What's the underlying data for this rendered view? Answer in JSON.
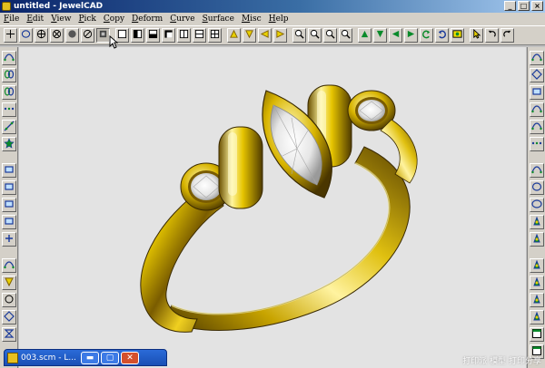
{
  "window": {
    "title": "untitled - JewelCAD",
    "controls": [
      "minimize",
      "maximize",
      "close"
    ],
    "control_glyphs": [
      "_",
      "□",
      "×"
    ]
  },
  "menu": [
    "File",
    "Edit",
    "View",
    "Pick",
    "Copy",
    "Deform",
    "Curve",
    "Surface",
    "Misc",
    "Help"
  ],
  "toolbar": {
    "buttons": [
      "crosshair-icon",
      "circle-icon",
      "target-icon",
      "circle-cross-icon",
      "filled-circle-icon",
      "slashed-circle-icon",
      "render-mode-icon",
      "view-square-icon",
      "view-half-icon",
      "view-bottom-icon",
      "view-corner-icon",
      "split-vertical-icon",
      "split-horizontal-icon",
      "grid-icon",
      "triangle-up-icon",
      "triangle-down-icon",
      "arrow-left-icon",
      "arrow-right-icon",
      "zoom-in-icon",
      "zoom-out-icon",
      "zoom-window-icon",
      "zoom-fit-icon",
      "triangle-up-green-icon",
      "triangle-down-green-icon",
      "arrow-left-green-icon",
      "arrow-right-green-icon",
      "rotate-left-icon",
      "rotate-right-icon",
      "scene-icon",
      "select-pointer-icon",
      "undo-icon",
      "redo-icon"
    ],
    "pressed": "render-mode-icon"
  },
  "left_tools": [
    "curve-tool-icon",
    "spring-tool-icon",
    "chain-tool-icon",
    "dots-tool-icon",
    "diagonal-tool-icon",
    "star-tool-icon",
    "rect-select-icon",
    "square-icon",
    "rect-wide-icon",
    "rect-tall-icon",
    "plus-tool-icon",
    "arc-icon",
    "triangle-down-icon",
    "triangle-outline-icon",
    "diamond-icon",
    "hourglass-icon"
  ],
  "right_tools": [
    "wave-icon",
    "curve-diamond-icon",
    "square-dots-icon",
    "bezier-icon",
    "curve-arc-icon",
    "dotted-line-icon",
    "squiggle-icon",
    "circle-icon",
    "ellipse-icon",
    "shape-a-icon",
    "shape-b-icon",
    "shape-c-icon",
    "shape-d-icon",
    "shape-e-icon",
    "shape-f-icon",
    "window-icon",
    "window-split-icon"
  ],
  "minimized_window": {
    "title": "003.scm - L..."
  },
  "watermark": "打印派  模型 打印分享",
  "colors": {
    "gold_light": "#fff6a0",
    "gold_mid": "#d8b400",
    "gold_dark": "#5a4200",
    "viewport_bg": "#e3e3e3",
    "title_bar": "#0a246a"
  }
}
